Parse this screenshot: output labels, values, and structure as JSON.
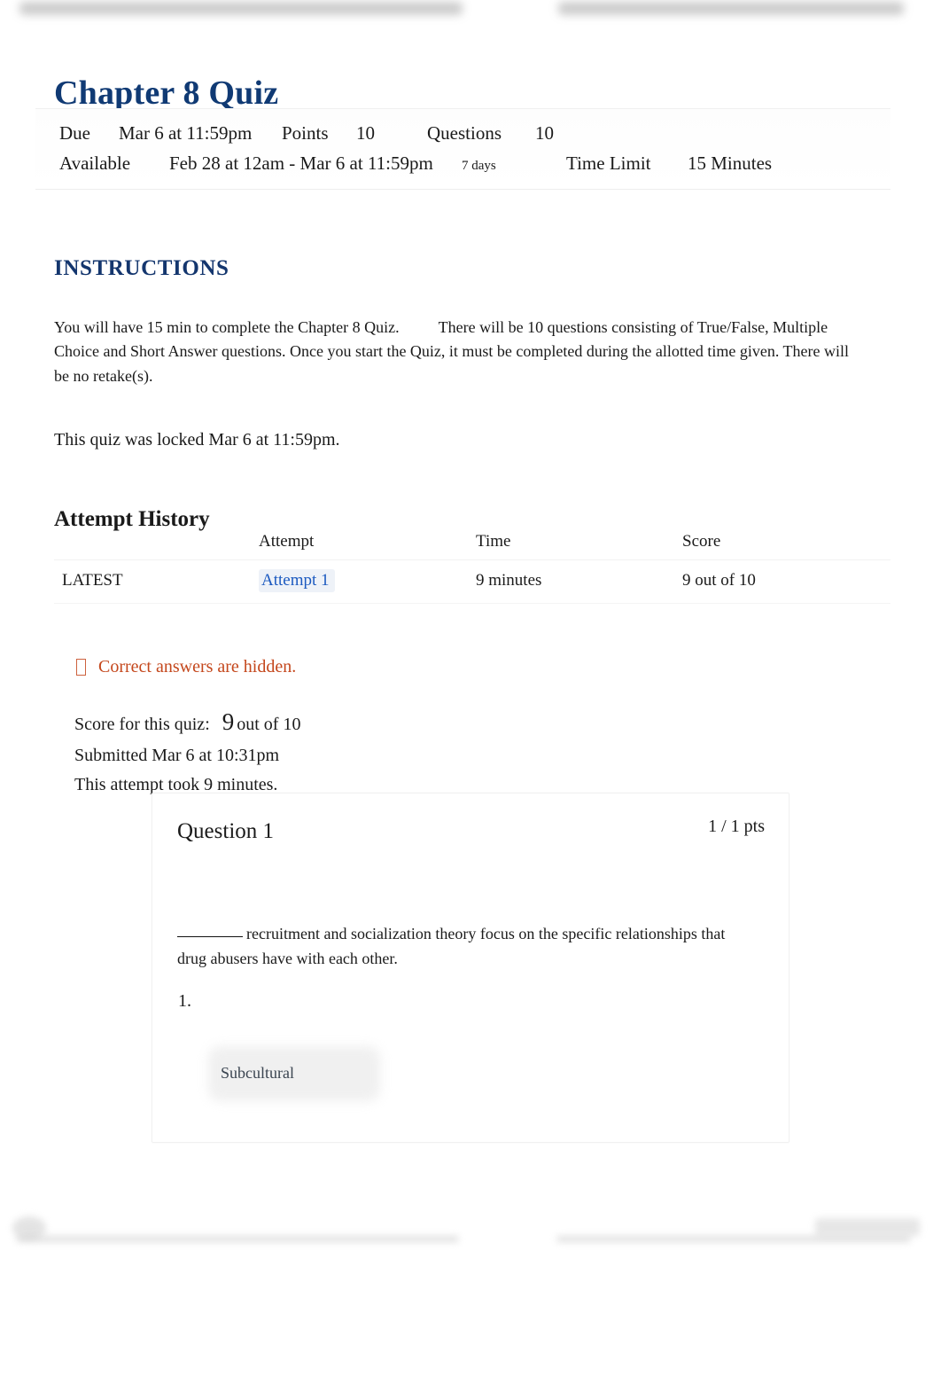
{
  "browser_chrome": {
    "top_bar_legible": false,
    "bottom_bar_legible": false
  },
  "page_title": "Chapter 8 Quiz",
  "meta": {
    "due_label": "Due",
    "due_value": "Mar 6 at 11:59pm",
    "points_label": "Points",
    "points_value": "10",
    "questions_label": "Questions",
    "questions_value": "10",
    "available_label": "Available",
    "available_value": "Feb 28 at 12am - Mar 6 at 11:59pm",
    "duration_value": "7 days",
    "time_limit_label": "Time Limit",
    "time_limit_value": "15 Minutes"
  },
  "instructions": {
    "heading": "INSTRUCTIONS",
    "paragraph_part1": "You will have 15 min to complete the Chapter 8 Quiz.",
    "paragraph_part2": "There will be 10 questions consisting of True/False, Multiple Choice and Short Answer questions. Once you start the Quiz, it must be completed during the allotted time given. There will be no retake(s)."
  },
  "locked_notice": "This quiz was locked Mar 6 at 11:59pm.",
  "attempt_history": {
    "heading": "Attempt History",
    "columns": [
      "",
      "Attempt",
      "Time",
      "Score"
    ],
    "rows": [
      {
        "latest_badge": "LATEST",
        "attempt": "Attempt 1",
        "time": "9 minutes",
        "score": "9 out of 10"
      }
    ]
  },
  "results": {
    "answers_hidden_icon": "box-glyph-icon",
    "answers_hidden_text": "Correct answers are hidden.",
    "score_label": "Score for this quiz:",
    "score_value": "9",
    "score_suffix": "out of 10",
    "submitted_text": "Submitted Mar 6 at 10:31pm",
    "duration_text": "This attempt took 9 minutes."
  },
  "question": {
    "title": "Question 1",
    "points": "1 / 1 pts",
    "text_after_blank": "recruitment and socialization theory focus on the specific relationships that drug abusers have with each other.",
    "answer_number": "1.",
    "answer_value": "Subcultural"
  },
  "colors": {
    "title_blue": "#103a74",
    "heading_blue": "#14366e",
    "link_blue": "#1c5ac0",
    "warning_orange": "#c4471c"
  }
}
